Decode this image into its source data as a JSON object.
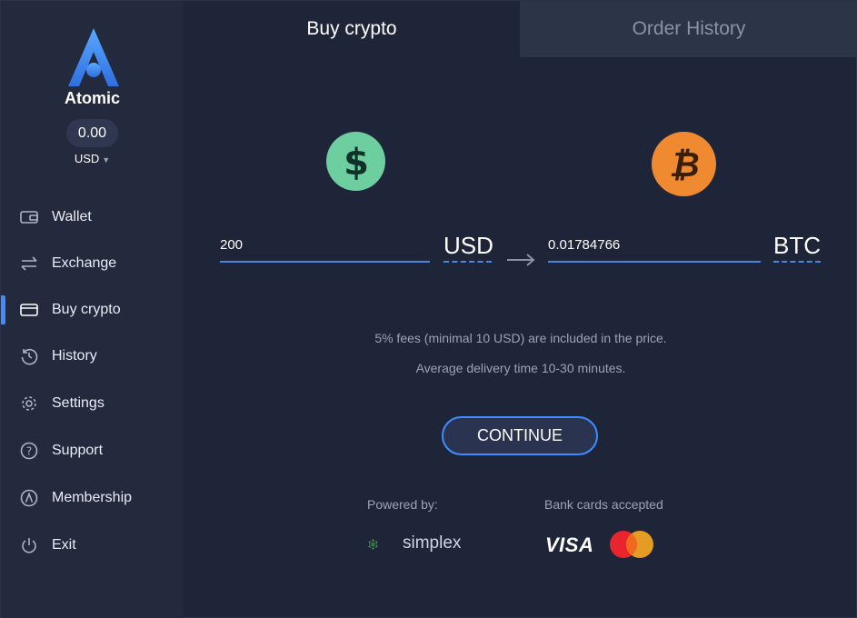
{
  "app": {
    "brand": "Atomic",
    "balance": "0.00",
    "currency": "USD"
  },
  "sidebar": {
    "items": [
      {
        "label": "Wallet",
        "icon": "wallet-icon"
      },
      {
        "label": "Exchange",
        "icon": "exchange-icon"
      },
      {
        "label": "Buy crypto",
        "icon": "card-icon",
        "active": true
      },
      {
        "label": "History",
        "icon": "history-icon"
      },
      {
        "label": "Settings",
        "icon": "gear-icon"
      },
      {
        "label": "Support",
        "icon": "help-icon"
      },
      {
        "label": "Membership",
        "icon": "atomic-icon"
      },
      {
        "label": "Exit",
        "icon": "power-icon"
      }
    ]
  },
  "tabs": {
    "buy": "Buy crypto",
    "orders": "Order History"
  },
  "exchange": {
    "from_amount": "200",
    "from_currency": "USD",
    "to_amount": "0.01784766",
    "to_currency": "BTC"
  },
  "info": {
    "fees": "5% fees (minimal 10 USD) are included in the price.",
    "delivery": "Average delivery time 10-30 minutes."
  },
  "actions": {
    "continue": "CONTINUE"
  },
  "footer": {
    "powered_by": "Powered by:",
    "provider": "simplex",
    "cards_label": "Bank cards accepted",
    "visa": "VISA"
  },
  "colors": {
    "accent": "#3f8cff",
    "usd_coin": "#6dcfa0",
    "btc_coin": "#f08a31",
    "background": "#1e2538",
    "sidebar": "#232a3e"
  }
}
